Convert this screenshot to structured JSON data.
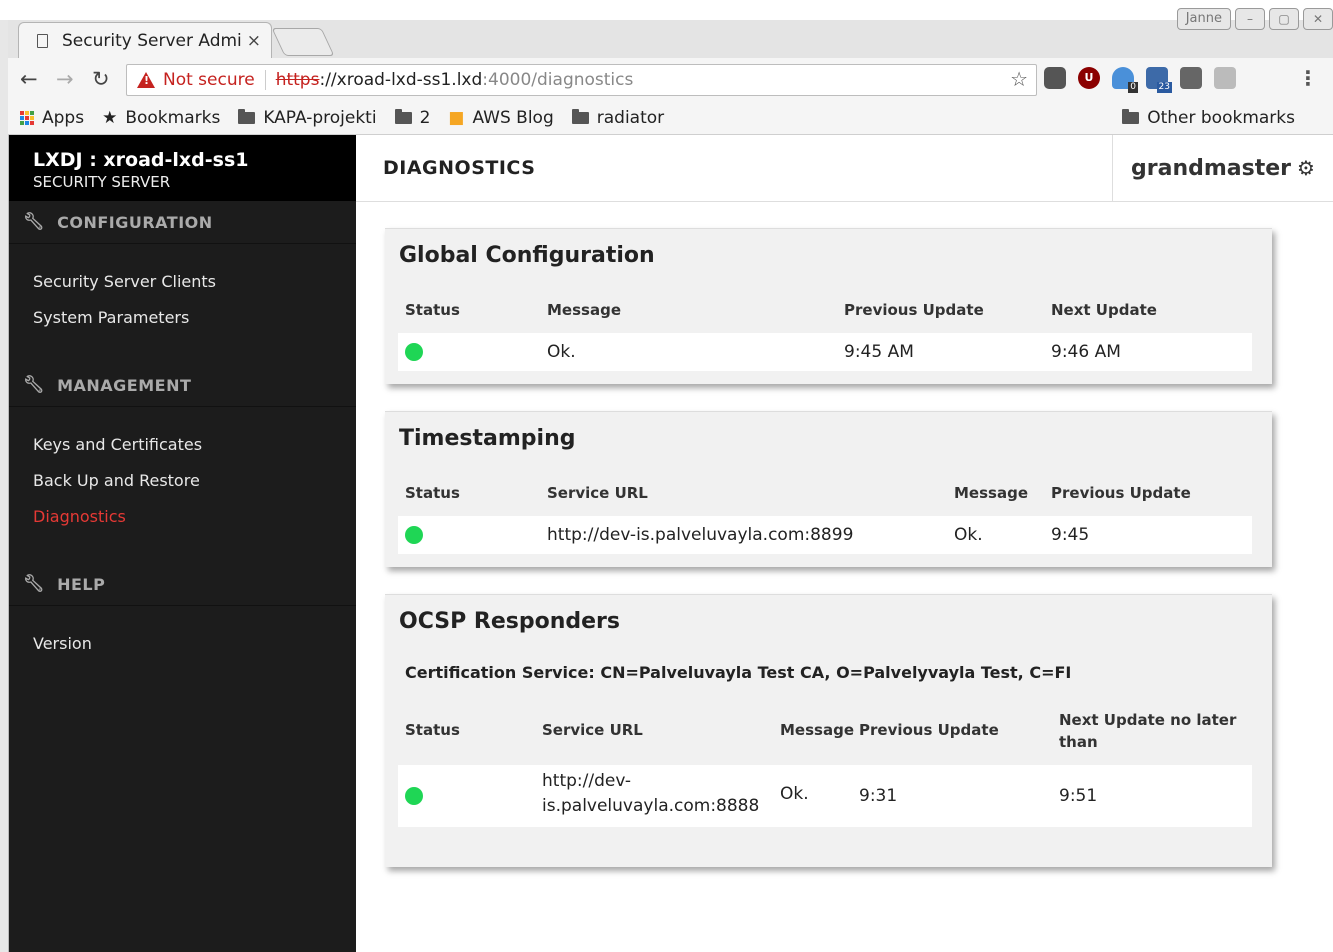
{
  "browser": {
    "tab_title": "Security Server Admi",
    "tab_close": "×",
    "user_button": "Janne",
    "security_label": "Not secure",
    "url_scheme": "https",
    "url_host": "://xroad-lxd-ss1.lxd",
    "url_rest": ":4000/diagnostics",
    "badge_ext1": "0",
    "badge_ext2": "23",
    "bookmarks": [
      "Apps",
      "Bookmarks",
      "KAPA-projekti",
      "2",
      "AWS Blog",
      "radiator"
    ],
    "other_bookmarks": "Other bookmarks"
  },
  "sidebar": {
    "brand_title": "LXDJ : xroad-lxd-ss1",
    "brand_subtitle": "SECURITY SERVER",
    "sections": [
      {
        "heading": "CONFIGURATION",
        "items": [
          "Security Server Clients",
          "System Parameters"
        ]
      },
      {
        "heading": "MANAGEMENT",
        "items": [
          "Keys and Certificates",
          "Back Up and Restore",
          "Diagnostics"
        ]
      },
      {
        "heading": "HELP",
        "items": [
          "Version"
        ]
      }
    ]
  },
  "header": {
    "page_title": "DIAGNOSTICS",
    "username": "grandmaster"
  },
  "global_configuration": {
    "title": "Global Configuration",
    "columns": [
      "Status",
      "Message",
      "Previous Update",
      "Next Update"
    ],
    "row": {
      "status": "ok",
      "message": "Ok.",
      "previous_update": "9:45 AM",
      "next_update": "9:46 AM"
    }
  },
  "timestamping": {
    "title": "Timestamping",
    "columns": [
      "Status",
      "Service URL",
      "Message",
      "Previous Update"
    ],
    "row": {
      "status": "ok",
      "service_url": "http://dev-is.palveluvayla.com:8899",
      "message": "Ok.",
      "previous_update": "9:45"
    }
  },
  "ocsp": {
    "title": "OCSP Responders",
    "certification_service": "Certification Service: CN=Palveluvayla Test CA, O=Palvelyvayla Test, C=FI",
    "columns": [
      "Status",
      "Service URL",
      "Message",
      "Previous Update",
      "Next Update no later than"
    ],
    "row": {
      "status": "ok",
      "service_url_line1": "http://dev-",
      "service_url_line2": "is.palveluvayla.com:8888",
      "message": "Ok.",
      "previous_update": "9:31",
      "next_update": "9:51"
    }
  },
  "colors": {
    "status_ok": "#1fd655",
    "active_nav": "#e53935",
    "sidebar_bg": "#1c1c1c"
  }
}
